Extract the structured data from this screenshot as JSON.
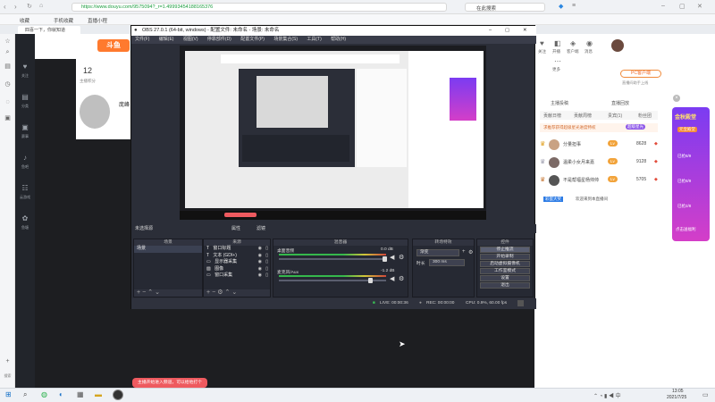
{
  "browser": {
    "url": "https://www.douyu.com/9575094?_r=1.49993454188165376",
    "search_label": "在此搜索",
    "bookmarks": [
      "收藏",
      "手机收藏",
      "直播小程"
    ],
    "tab_label": "四喜一下，你就知道"
  },
  "side_bar": {
    "icons": [
      "star-icon",
      "search-icon",
      "bookmark-icon",
      "history-icon",
      "chat-icon",
      "bag-icon"
    ],
    "bottom_label": "搜索"
  },
  "nav": {
    "items": [
      {
        "icon": "♥",
        "label": "关注"
      },
      {
        "icon": "▤",
        "label": "分类"
      },
      {
        "icon": "▣",
        "label": "赛事"
      },
      {
        "icon": "♪",
        "label": "鱼吧"
      },
      {
        "icon": "☷",
        "label": "云游戏"
      },
      {
        "icon": "✿",
        "label": "鱼塘"
      }
    ]
  },
  "page": {
    "room_num": "12",
    "room_label": "主播积分",
    "streamer_name": "庞峰"
  },
  "right_panel": {
    "top_icons": [
      {
        "icon": "♥",
        "label": "关注"
      },
      {
        "icon": "◧",
        "label": "开播"
      },
      {
        "icon": "◈",
        "label": "客户端"
      },
      {
        "icon": "◉",
        "label": "消息"
      },
      {
        "icon": "⋯",
        "label": "更多"
      }
    ],
    "pc_client_button": "PC客户端",
    "pc_client_sub": "直播间助手上线",
    "section_tabs": [
      "主播投稿",
      "直播回放"
    ],
    "rank_tabs": [
      "贡献日榜",
      "贡献周榜",
      "贵宾(1)",
      "粉丝团"
    ],
    "banner_text": "求推荐获得超级星光进度特权",
    "banner_badge": "超级星光",
    "rank_rows": [
      {
        "name": "分量担事",
        "level": "Lv",
        "value": "8628"
      },
      {
        "name": "温柔小女月来嘉",
        "level": "Lv",
        "value": "9128"
      },
      {
        "name": "不是帮福星杨帅帅",
        "level": "Lv",
        "value": "5705"
      }
    ],
    "footer_note": "欢迎来到本直播间",
    "footer_link": "彩蛋大奖",
    "ad_title": "金秋殿堂",
    "ad_subtitle": "元宝殿堂",
    "ad_items": [
      "已抢8/9",
      "已抢8/9",
      "已抢2/8"
    ],
    "ad_footer": "点击送福利"
  },
  "obs": {
    "title": "OBS 27.0.1 (64-bit, windows) - 配置文件: 未命名 - 场景: 未命名",
    "menu": [
      "文件(F)",
      "编辑(E)",
      "视图(V)",
      "停靠部件(D)",
      "配置文件(P)",
      "场景集合(S)",
      "工具(T)",
      "帮助(H)"
    ],
    "source_not_selected": "未选择源",
    "properties_btn": "属性",
    "filters_btn": "滤镜",
    "docks": {
      "scenes": "场景",
      "sources": "来源",
      "mixer": "混音器",
      "transitions": "转场特效",
      "controls": "控件"
    },
    "scenes": [
      "场景"
    ],
    "sources": [
      {
        "icon": "T",
        "name": "窗口标题"
      },
      {
        "icon": "T",
        "name": "文本 (GDI+)"
      },
      {
        "icon": "▭",
        "name": "显示器采集"
      },
      {
        "icon": "▨",
        "name": "图像"
      },
      {
        "icon": "▭",
        "name": "窗口采集"
      }
    ],
    "mixer": [
      {
        "name": "桌面音频",
        "db": "0.0 dB"
      },
      {
        "name": "麦克风/Aux",
        "db": "-1.2 dB"
      }
    ],
    "transition": {
      "type": "渐变",
      "duration_label": "时长",
      "duration": "300 ms"
    },
    "controls": [
      "停止推流",
      "开始录制",
      "启动虚拟摄像机",
      "工作室模式",
      "设置",
      "退出"
    ],
    "status": {
      "live": "LIVE: 00:00:36",
      "rec": "REC: 00:00:00",
      "cpu": "CPU: 0.9%, 60.00 fps"
    }
  },
  "notice_text": "主播开始进入频道，可以给他打个",
  "taskbar": {
    "time": "13:05",
    "date": "2021/7/25",
    "apps": [
      "windows-icon",
      "search-icon",
      "wechat-icon",
      "edge-icon",
      "store-icon",
      "explorer-icon",
      "obs-icon"
    ]
  }
}
